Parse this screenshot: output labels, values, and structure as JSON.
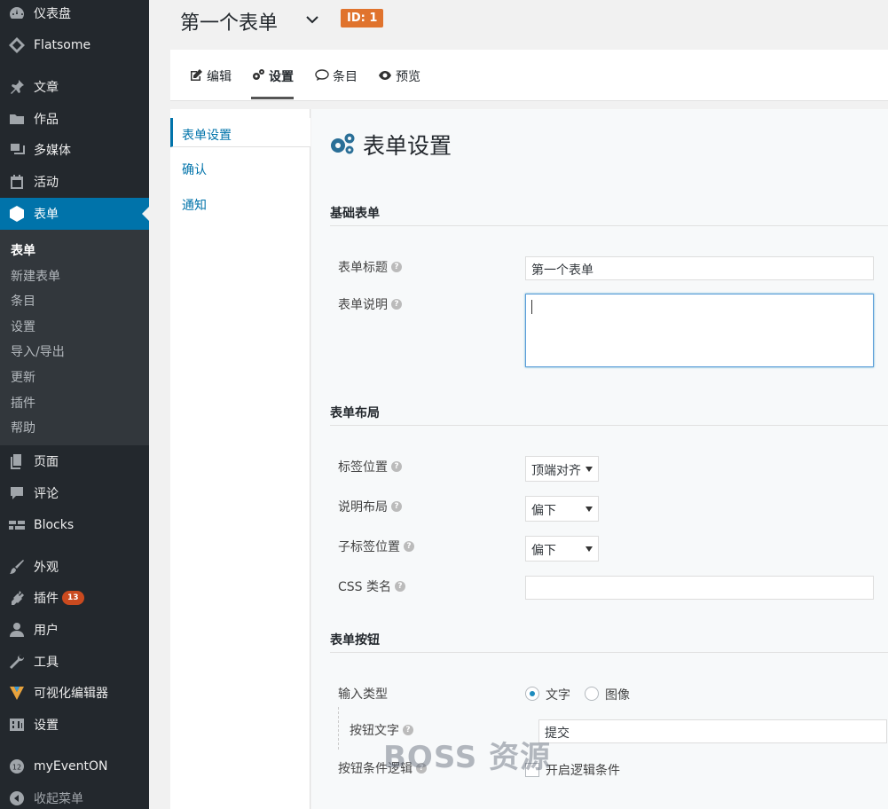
{
  "sidebar": {
    "items": [
      {
        "label": "仪表盘",
        "icon": "dashboard-icon"
      },
      {
        "label": "Flatsome",
        "icon": "flatsome-icon"
      },
      {
        "label": "文章",
        "icon": "pin-icon"
      },
      {
        "label": "作品",
        "icon": "folder-icon"
      },
      {
        "label": "多媒体",
        "icon": "media-icon"
      },
      {
        "label": "活动",
        "icon": "calendar-icon"
      },
      {
        "label": "表单",
        "icon": "forms-icon"
      },
      {
        "label": "页面",
        "icon": "pages-icon"
      },
      {
        "label": "评论",
        "icon": "comment-icon"
      },
      {
        "label": "Blocks",
        "icon": "blocks-icon"
      },
      {
        "label": "外观",
        "icon": "brush-icon"
      },
      {
        "label": "插件",
        "icon": "plugin-icon",
        "badge": "13"
      },
      {
        "label": "用户",
        "icon": "user-icon"
      },
      {
        "label": "工具",
        "icon": "wrench-icon"
      },
      {
        "label": "可视化编辑器",
        "icon": "editor-icon"
      },
      {
        "label": "设置",
        "icon": "settings-icon"
      },
      {
        "label": "myEventON",
        "icon": "eventon-icon"
      },
      {
        "label": "收起菜单",
        "icon": "collapse-icon"
      }
    ],
    "submenu": [
      "表单",
      "新建表单",
      "条目",
      "设置",
      "导入/导出",
      "更新",
      "插件",
      "帮助"
    ],
    "active_color": "#0073aa"
  },
  "header": {
    "title": "第一个表单",
    "id_badge": "ID: 1"
  },
  "tabs": [
    {
      "label": "编辑",
      "icon": "edit-icon"
    },
    {
      "label": "设置",
      "icon": "gears-icon",
      "active": true
    },
    {
      "label": "条目",
      "icon": "comment-icon"
    },
    {
      "label": "预览",
      "icon": "eye-icon"
    }
  ],
  "settings_nav": [
    "表单设置",
    "确认",
    "通知"
  ],
  "panel": {
    "title": "表单设置",
    "sections": {
      "basic": "基础表单",
      "layout": "表单布局",
      "button": "表单按钮"
    },
    "fields": {
      "form_title_label": "表单标题",
      "form_title_value": "第一个表单",
      "form_desc_label": "表单说明",
      "label_position_label": "标签位置",
      "label_position_value": "顶端对齐",
      "desc_layout_label": "说明布局",
      "desc_layout_value": "偏下",
      "sublabel_position_label": "子标签位置",
      "sublabel_position_value": "偏下",
      "css_class_label": "CSS 类名",
      "input_type_label": "输入类型",
      "input_type_text": "文字",
      "input_type_image": "图像",
      "button_text_label": "按钮文字",
      "button_text_value": "提交",
      "button_logic_label": "按钮条件逻辑",
      "button_logic_option": "开启逻辑条件"
    },
    "help_glyph": "?"
  },
  "watermark": "BOSS 资源"
}
